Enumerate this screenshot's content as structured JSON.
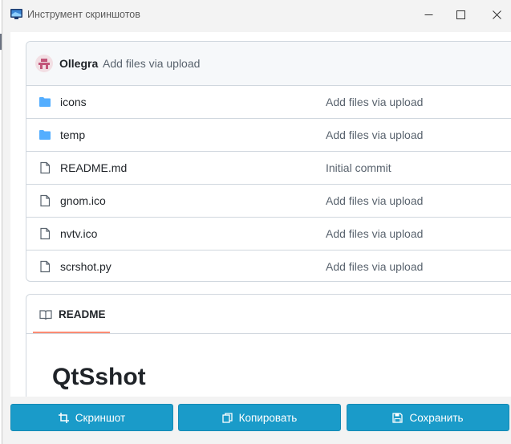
{
  "window": {
    "title": "Инструмент скриншотов",
    "controls": {
      "minimize": "—",
      "maximize": "☐",
      "close": "✕"
    }
  },
  "repo": {
    "commit": {
      "author": "Ollegra",
      "message": "Add files via upload"
    },
    "files": [
      {
        "type": "folder",
        "name": "icons",
        "message": "Add files via upload"
      },
      {
        "type": "folder",
        "name": "temp",
        "message": "Add files via upload"
      },
      {
        "type": "file",
        "name": "README.md",
        "message": "Initial commit"
      },
      {
        "type": "file",
        "name": "gnom.ico",
        "message": "Add files via upload"
      },
      {
        "type": "file",
        "name": "nvtv.ico",
        "message": "Add files via upload"
      },
      {
        "type": "file",
        "name": "scrshot.py",
        "message": "Add files via upload"
      }
    ]
  },
  "readme": {
    "tab_label": "README",
    "heading": "QtSshot"
  },
  "toolbar": {
    "screenshot_label": "Скриншот",
    "copy_label": "Копировать",
    "save_label": "Сохранить"
  },
  "colors": {
    "button": "#1a9bc9",
    "folder": "#54aeff",
    "tab_underline": "#fd8c73"
  }
}
